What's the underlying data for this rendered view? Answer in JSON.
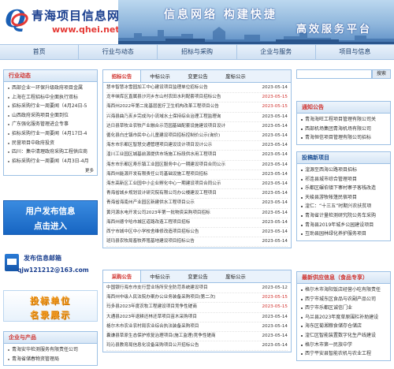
{
  "header": {
    "site_name": "青海项目信息网",
    "url": "www.qhei.net.cn",
    "slogan1": "信息网络  构建快捷",
    "slogan2": "高效服务平台"
  },
  "nav": [
    "首页",
    "行业与动态",
    "招标与采购",
    "企业与服务",
    "项目与信息"
  ],
  "left": {
    "industry_title": "行业动态",
    "industry_items": [
      "西部企业一环保升级政府项目金属",
      "上海在工程招标中全面执行双标",
      "招标采购行业一周要闻（4月24日-5",
      "山西政府采购项目全面到位",
      "广东强化服务管理进企专事",
      "招标采购行业一周要闻（4月17日-4",
      "民营项目中政府投资",
      "四川：集中清理政府采购工程供应商",
      "招标采购行业一周要闻（4月3日-4月"
    ],
    "more": "更多",
    "promo1_line1": "用户发布信息",
    "promo1_line2": "点击进入",
    "promo2_title": "发布信息邮箱",
    "promo2_email": "qjw121212@163.com",
    "promo3_line1": "投标单位",
    "promo3_line2": "名录展示",
    "company_title": "企业与产品",
    "company_items": [
      "青海安华检测服务有限责任公司",
      "青海省储春物资管理局"
    ]
  },
  "center": {
    "tabs1": [
      "招标公告",
      "中标公示",
      "变更公告",
      "废标公示"
    ],
    "rows1": [
      {
        "title": "慧丰智慧冰雪园加工中心建设项目监理单位招标公告",
        "date": "2023-05-14",
        "hot": false
      },
      {
        "title": "龙羊峡库区直属县沙河乡东山村农田水利配套项目招标公告",
        "date": "2023-05-15",
        "hot": true
      },
      {
        "title": "海西州2022年第二批基层医疗卫生机构改革工程项目公告",
        "date": "2023-05-15",
        "hot": true
      },
      {
        "title": "兴海县曲乃亥乡完成沟小流域水土保持综合治理工程监理询",
        "date": "2023-05-14",
        "hot": false
      },
      {
        "title": "达日县草牧业农牧产业融合示范园基础配套设施建设项目设计",
        "date": "2023-05-14",
        "hot": false
      },
      {
        "title": "循化县白庄镇市民中心儿童建设项目招标控制价公示(询价)",
        "date": "2023-05-14",
        "hot": false
      },
      {
        "title": "海东市乐都区智慧交通管理项目建设设计项目设计公示",
        "date": "2023-05-14",
        "hot": false
      },
      {
        "title": "湟川工业园区城基前源提供市场施工标段供水用工程项目",
        "date": "2023-05-14",
        "hot": false
      },
      {
        "title": "海东市乐都区寿乐镇工业园区服务中心一期建设项目合同公示",
        "date": "2023-05-14",
        "hot": false
      },
      {
        "title": "海西州能源开发有限责任公司基础设施工程项目招标",
        "date": "2023-05-14",
        "hot": false
      },
      {
        "title": "海东高新区工业园中小企业孵化中心一期建设项目合同公示",
        "date": "2023-05-14",
        "hot": false
      },
      {
        "title": "青海省城乡规划设计研究院有限公司办公楼建设工程项目",
        "date": "2023-05-14",
        "hot": false
      },
      {
        "title": "青海省海南州产业园区新建供水工程项目公示",
        "date": "2023-05-14",
        "hot": false
      },
      {
        "title": "黄河源水电开发公司2023年第一批物资采购项目招标",
        "date": "2023-05-14",
        "hot": false
      },
      {
        "title": "海西州德令哈市城区道路改造工程项目招标",
        "date": "2023-05-14",
        "hot": false
      },
      {
        "title": "西宁市城中区中小学校舍维修改造项目招标公告",
        "date": "2023-05-14",
        "hot": false
      },
      {
        "title": "班玛县农牧局畜牧养殖基地建设项目招标公告",
        "date": "2023-05-14",
        "hot": false
      }
    ],
    "tabs2": [
      "采购公告",
      "中标公示",
      "变更公告",
      "废标公示"
    ],
    "rows2": [
      {
        "title": "中国银行海东市支行营业场所安全防范系统建设项目",
        "date": "2023-05-12",
        "hot": false
      },
      {
        "title": "海西州中级人民法院办案办公业务装备采购项目(第二次)",
        "date": "2023-05-15",
        "hot": true
      },
      {
        "title": "玛多县2023年度农牧工程建设项目竞争性磋商",
        "date": "2023-05-15",
        "hot": true
      },
      {
        "title": "大通县2023年退耕还林还草项目苗木采购项目",
        "date": "2023-05-14",
        "hot": false
      },
      {
        "title": "格尔木市农业农村局农业综合执法装备采购项目",
        "date": "2023-05-14",
        "hot": false
      },
      {
        "title": "囊谦县草原生态保护修复治理项目(施工监理)竞争性磋商",
        "date": "2023-05-14",
        "hot": false
      },
      {
        "title": "玛沁县教育局信息化设备采购项目公开招标公告",
        "date": "2023-05-14",
        "hot": false
      }
    ],
    "more": "更多"
  },
  "right": {
    "search_button": "搜索",
    "notice_title": "通知公告",
    "notice_items": [
      "青海海旺工程项目管理有限公司关",
      "西部机场集团青海机场有限公司",
      "青海恒信项目管理有限公司招标"
    ],
    "recommend_title": "投稿新项目",
    "recommend_items": [
      "湟源至西海公路项目招标",
      "祁连县城市综合管理项目",
      "乐都区碾伯镇下寨村寨子客栈改造",
      "天峻县游牧帐篷民宿项目",
      "湟仁：“十三五”时期兴农扶贫项",
      "青海省计量检测研究院公务车采购",
      "青海县2019年城乡公园建设项目",
      "互助县园林绿化养护服务项目"
    ],
    "supply_title": "最新供应信息（食品专享）",
    "supply_items": [
      "格尔木市海阳饭店经营小吃有限责任",
      "西宁市城东区食品与农副产品公司",
      "西宁市乐都区诚信门业",
      "乌兰县2023年度草原围栏补助建设",
      "海东区菊湘粮食储存仓储店",
      "湟仁区智能装置数字化生产线建设",
      "格尔木市第一民族中学",
      "西宁平安县智能农机与农业工程"
    ]
  },
  "colors": {
    "accent": "#1a5fb4",
    "hot": "#d0312d",
    "border": "#9cc0e4"
  }
}
